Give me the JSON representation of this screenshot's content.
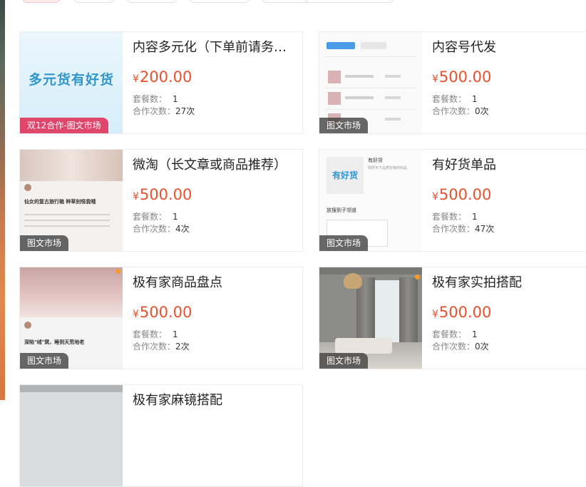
{
  "labels": {
    "package_count": "套餐数：",
    "coop_count": "合作次数：",
    "currency": "¥"
  },
  "products": [
    {
      "title": "内容多元化（下单前请务必...",
      "price": "200.00",
      "packages": "1",
      "coop": "27次",
      "tag": "双12合作-图文市场",
      "thumb_text": "多元货有好货"
    },
    {
      "title": "内容号代发",
      "price": "500.00",
      "packages": "1",
      "coop": "0次",
      "tag": "图文市场"
    },
    {
      "title": "微淘（长文章或商品推荐）",
      "price": "500.00",
      "packages": "1",
      "coop": "4次",
      "tag": "图文市场",
      "thumb_text": "仙女的复古旅行箱 种草别怪我哦"
    },
    {
      "title": "有好货单品",
      "price": "500.00",
      "packages": "1",
      "coop": "47次",
      "tag": "图文市场",
      "thumb_logo": "有好货",
      "thumb_line1": "有好货",
      "thumb_line2": "网罗天下品质好物的商品",
      "thumb_line3": "放搜到子领道"
    },
    {
      "title": "极有家商品盘点",
      "price": "500.00",
      "packages": "1",
      "coop": "2次",
      "tag": "图文市场",
      "thumb_text": "深陷\"绒\"窝，睡到天荒地老"
    },
    {
      "title": "极有家实拍搭配",
      "price": "500.00",
      "packages": "1",
      "coop": "0次",
      "tag": "图文市场"
    },
    {
      "title": "极有家麻镜搭配"
    }
  ],
  "colors": {
    "price": "#e8502e",
    "tag_pink": "#e0466b",
    "tag_dark": "#3c3c3c"
  }
}
